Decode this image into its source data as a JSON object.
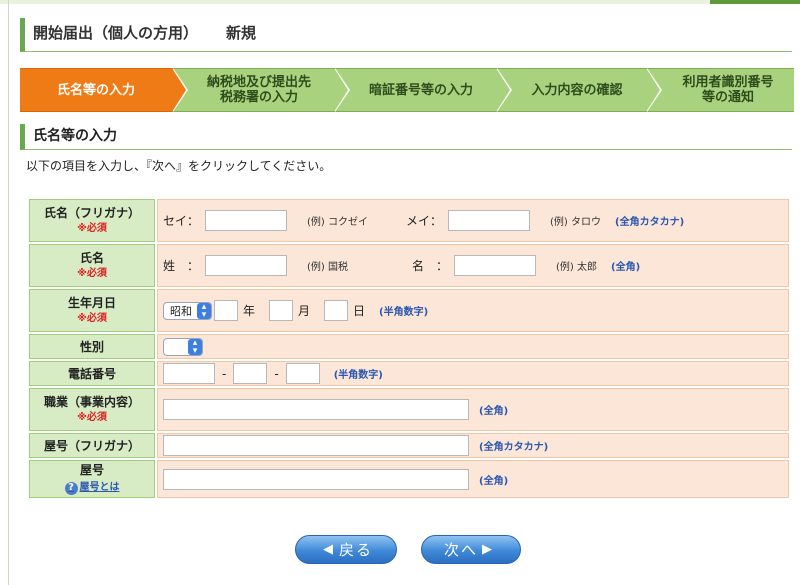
{
  "page_title": "開始届出（個人の方用）",
  "page_mode": "新規",
  "steps": [
    {
      "label_line1": "氏名等の入力",
      "label_line2": ""
    },
    {
      "label_line1": "納税地及び提出先",
      "label_line2": "税務署の入力"
    },
    {
      "label_line1": "暗証番号等の入力",
      "label_line2": ""
    },
    {
      "label_line1": "入力内容の確認",
      "label_line2": ""
    },
    {
      "label_line1": "利用者識別番号",
      "label_line2": "等の通知"
    }
  ],
  "section_title": "氏名等の入力",
  "instruction": "以下の項目を入力し、『次へ』をクリックしてください。",
  "required_mark": "※必須",
  "rows": {
    "kana": {
      "label": "氏名（フリガナ）",
      "sei_label": "セイ：",
      "sei_example": "(例) コクゼイ",
      "mei_label": "メイ：",
      "mei_example": "(例) タロウ",
      "hint": "(全角カタカナ)"
    },
    "name": {
      "label": "氏名",
      "sei_label": "姓　：",
      "sei_example": "(例) 国税",
      "mei_label": "名　：",
      "mei_example": "(例) 太郎",
      "hint": "(全角)"
    },
    "birth": {
      "label": "生年月日",
      "era_selected": "昭和",
      "year_unit": "年",
      "month_unit": "月",
      "day_unit": "日",
      "hint": "(半角数字)"
    },
    "gender": {
      "label": "性別",
      "selected": ""
    },
    "phone": {
      "label": "電話番号",
      "sep": "-",
      "hint": "(半角数字)"
    },
    "occupation": {
      "label": "職業（事業内容）",
      "hint": "(全角)"
    },
    "shop_kana": {
      "label": "屋号（フリガナ）",
      "hint": "(全角カタカナ)"
    },
    "shop": {
      "label": "屋号",
      "help_link": "屋号とは",
      "hint": "(全角)"
    }
  },
  "buttons": {
    "back": "戻る",
    "next": "次へ"
  },
  "icons": {
    "back_arrow": "left-arrow-icon",
    "next_arrow": "right-arrow-icon",
    "help": "question-icon",
    "select_chevron": "updown-chevron-icon"
  },
  "colors": {
    "active_step": "#ef7b17",
    "step": "#a8d27e",
    "label_cell": "#d7ecc5",
    "input_cell": "#fbe6d7",
    "required": "#e02020",
    "hint": "#2a57b0"
  }
}
